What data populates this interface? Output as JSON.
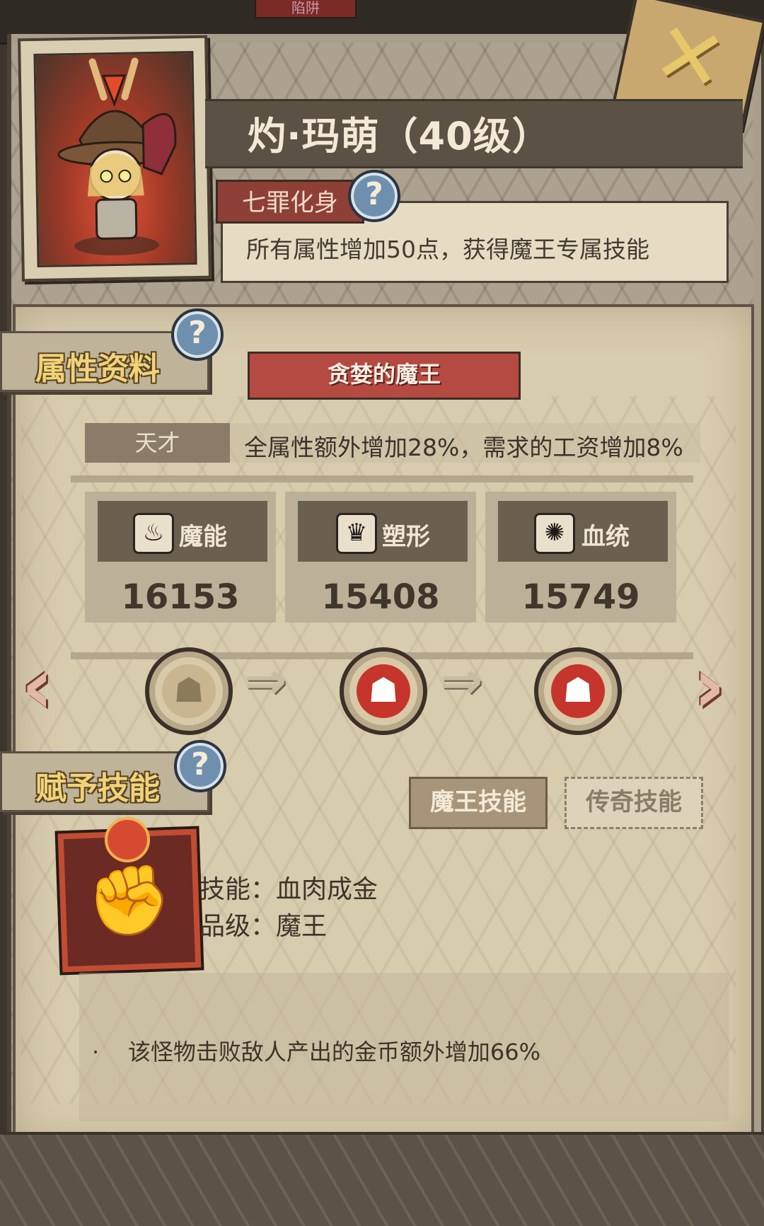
{
  "top_tab": "陷阱",
  "character": {
    "title": "灼·玛萌（40级）",
    "trait_tag": "七罪化身",
    "trait_desc": "所有属性增加50点，获得魔王专属技能"
  },
  "sections": {
    "attributes": "属性资料",
    "skills": "赋予技能"
  },
  "form_name": "贪婪的魔王",
  "talent": {
    "label": "天才",
    "desc": "全属性额外增加28%，需求的工资增加8%"
  },
  "stats": [
    {
      "name": "魔能",
      "value": "16153",
      "icon": "magic-energy-icon"
    },
    {
      "name": "塑形",
      "value": "15408",
      "icon": "physique-icon"
    },
    {
      "name": "血统",
      "value": "15749",
      "icon": "bloodline-icon"
    }
  ],
  "skill_tabs": {
    "demon": "魔王技能",
    "legend": "传奇技能"
  },
  "skill": {
    "name_line": "技能：血肉成金",
    "grade_line": "品级：魔王",
    "desc": "该怪物击败敌人产出的金币额外增加66%"
  },
  "colors": {
    "accent_red": "#b54a42",
    "parchment": "#d8ccae",
    "gold_label": "#f0d37a"
  }
}
